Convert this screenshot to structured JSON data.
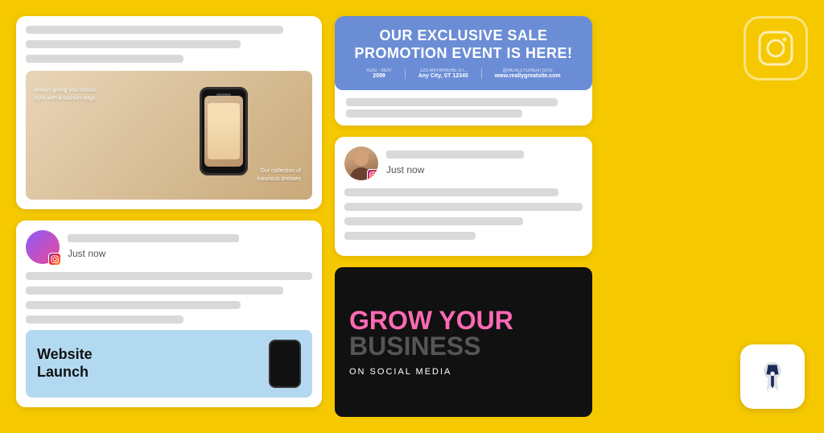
{
  "background_color": "#F5C800",
  "left_col": {
    "card_top": {
      "lines": [
        "long",
        "medium",
        "short"
      ],
      "phone_text_left": "always giving you classic style with a fashion edge.",
      "phone_text_right": "Our collection of luxurious dresses"
    },
    "card_bottom": {
      "time": "Just now",
      "lines": [
        "full",
        "long",
        "medium",
        "short"
      ],
      "website_launch": {
        "title": "Website\nLaunch"
      }
    }
  },
  "right_col": {
    "sale_card": {
      "title": "Our Exclusive Sale\nPromotion Event Is Here!",
      "details": [
        {
          "label": "AUG - NOV",
          "value": "2099"
        },
        {
          "label": "123 Anywhere St.,",
          "value": "Any City, ST 12345"
        },
        {
          "label": "@ReallyGreatSite",
          "value": "www.reallygreatsite.com"
        }
      ]
    },
    "social_card": {
      "time": "Just now",
      "lines": [
        "long",
        "full",
        "medium",
        "short"
      ]
    },
    "grow_card": {
      "line1_pink": "GROW YOUR",
      "line2_gray": "BUSINESS",
      "subtitle": "ON SOCIAL MEDIA"
    }
  },
  "icons": {
    "instagram": "instagram-icon",
    "pinterest": "pinterest-icon"
  }
}
